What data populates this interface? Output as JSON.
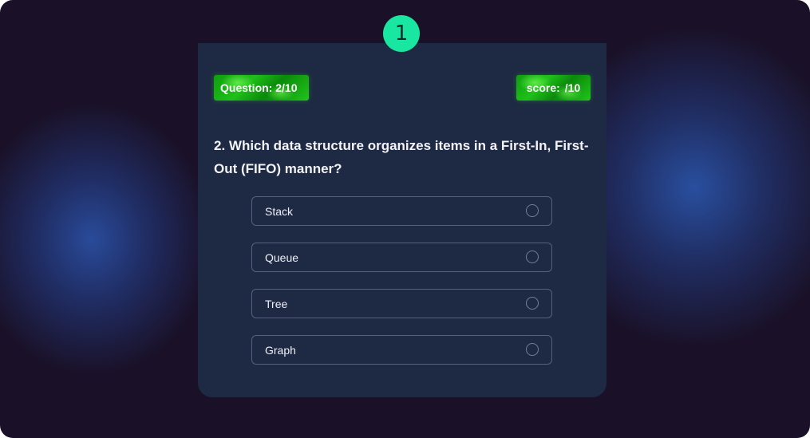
{
  "timer": {
    "value": "1"
  },
  "header": {
    "question_label": "Question:",
    "question_progress": "2/10",
    "score_label": "score:",
    "score_value": "/10"
  },
  "question": {
    "text": "2. Which data structure organizes items in a First-In, First-Out (FIFO) manner?"
  },
  "options": [
    {
      "label": "Stack"
    },
    {
      "label": "Queue"
    },
    {
      "label": "Tree"
    },
    {
      "label": "Graph"
    }
  ],
  "colors": {
    "accent": "#19e6a1",
    "badge": "#1fc01a",
    "card": "#1e2a43",
    "background": "#1a1128"
  }
}
